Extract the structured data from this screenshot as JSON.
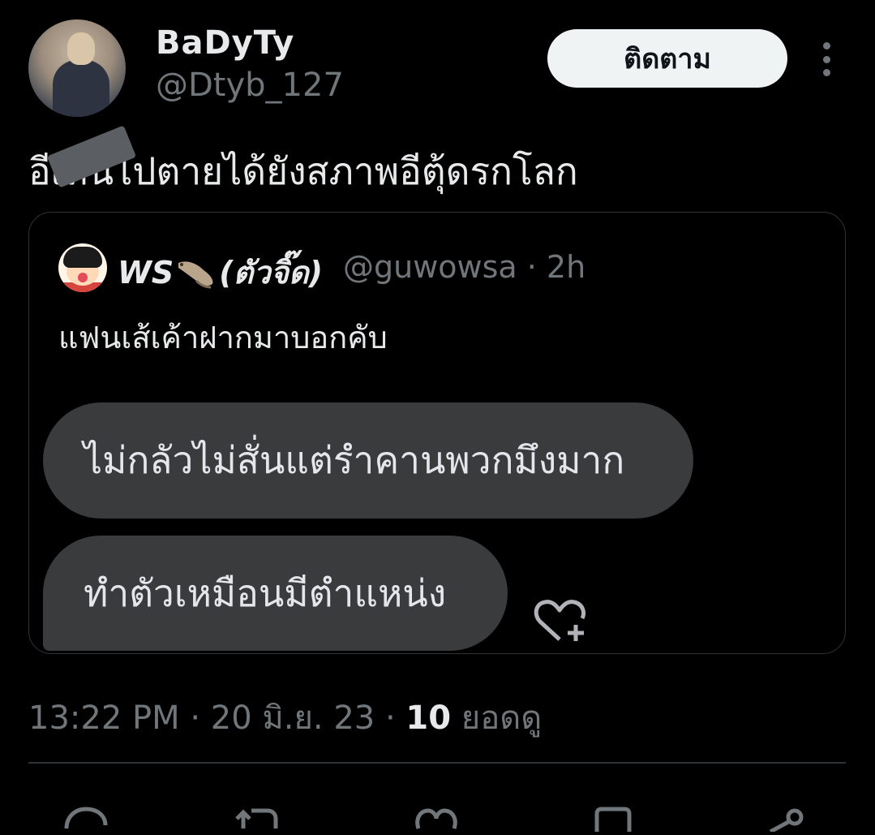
{
  "author": {
    "display_name": "BaDyTy",
    "handle": "@Dtyb_127",
    "follow_label": "ติดตาม"
  },
  "tweet": {
    "text": "อีเหน่ไปตายได้ยังสภาพอีตุ้ดรกโลก"
  },
  "quoted": {
    "display_name": "WS",
    "name_suffix": "(ตัวจิ๊ด)",
    "meta": "@guwowsa · 2h",
    "text": "แฟนเส้เค้าฝากมาบอกคับ",
    "bubbles": [
      "ไม่กลัวไม่สั่นแต่รำคานพวกมึงมาก",
      "ทำตัวเหมือนมีตำแหน่ง"
    ]
  },
  "footer": {
    "time_date": "13:22 PM · 20 มิ.ย. 23 · ",
    "views_count": "10",
    "views_label": " ยอดดู"
  },
  "colors": {
    "background": "#000000",
    "text": "#e7e9ea",
    "muted": "#71767b",
    "bubble": "#3a3b3c",
    "follow_bg": "#eff3f4"
  },
  "icons": [
    "more-icon",
    "heart-plus-icon",
    "reply-icon",
    "retweet-icon",
    "like-icon",
    "bookmark-icon",
    "share-icon"
  ]
}
